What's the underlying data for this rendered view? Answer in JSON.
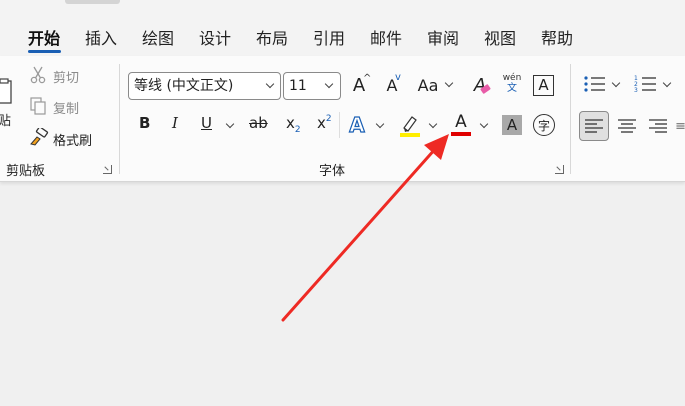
{
  "tabs": [
    {
      "label": "开始",
      "active": true
    },
    {
      "label": "插入"
    },
    {
      "label": "绘图"
    },
    {
      "label": "设计"
    },
    {
      "label": "布局"
    },
    {
      "label": "引用"
    },
    {
      "label": "邮件"
    },
    {
      "label": "审阅"
    },
    {
      "label": "视图"
    },
    {
      "label": "帮助"
    }
  ],
  "clipboard": {
    "paste_label": "贴",
    "cut_label": "剪切",
    "copy_label": "复制",
    "format_painter_label": "格式刷",
    "group_label": "剪贴板"
  },
  "font": {
    "font_name": "等线 (中文正文)",
    "font_size": "11",
    "grow_label": "A",
    "shrink_label": "A",
    "case_label": "Aa",
    "clear_label": "A",
    "phonetic_top": "wén",
    "phonetic_bottom": "文",
    "border_label": "A",
    "bold_label": "B",
    "italic_label": "I",
    "underline_label": "U",
    "strike_label": "ab",
    "subscript_label": "x",
    "subscript_mark": "2",
    "superscript_label": "x",
    "superscript_mark": "2",
    "effects_label": "A",
    "font_color_label": "A",
    "shading_label": "A",
    "enclose_label": "字",
    "group_label": "字体"
  },
  "colors": {
    "accent": "#1a5fb4",
    "font_color_bar": "#e00000",
    "highlight_bar": "#ffee00",
    "arrow": "#ee2a24"
  }
}
